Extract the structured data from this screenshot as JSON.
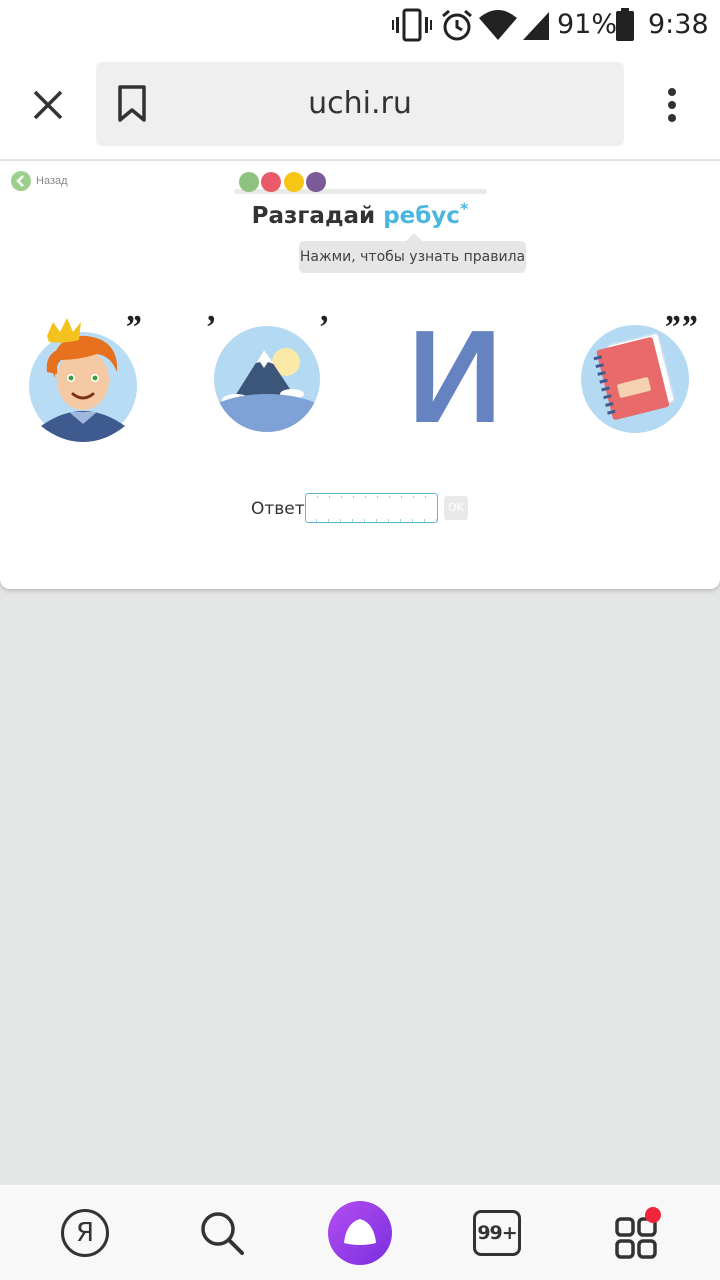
{
  "status_bar": {
    "battery_percent": "91%",
    "time": "9:38",
    "icons": [
      "vibrate-icon",
      "alarm-icon",
      "wifi-icon",
      "signal-icon",
      "battery-icon"
    ]
  },
  "browser": {
    "url": "uchi.ru",
    "icons": [
      "close-icon",
      "bookmark-icon",
      "more-menu-icon"
    ]
  },
  "page": {
    "back_label": "Назад",
    "progress_dot_colors": [
      "#90c27f",
      "#ea5b6a",
      "#f7c515",
      "#7a5b97"
    ],
    "title_prefix": "Разгадай",
    "title_accent": "ребус",
    "title_star": "*",
    "tooltip": "Нажми, чтобы узнать правила",
    "rebus": [
      {
        "image": "prince-icon",
        "marks": "”"
      },
      {
        "image": "mountain-icon",
        "mark_left": "’",
        "mark_right": "’"
      },
      {
        "letter": "И"
      },
      {
        "image": "notebook-icon",
        "marks": "””"
      }
    ],
    "answer_label": "Ответ:",
    "answer_value": "",
    "ok_label": "OK",
    "accent_color": "#4bb6e0"
  },
  "bottom_nav": {
    "yandex_label": "Я",
    "tabs_count": "99+",
    "icons": [
      "yandex-icon",
      "search-icon",
      "alice-icon",
      "tabs-icon",
      "apps-icon"
    ],
    "notification_color": "#f0243a"
  }
}
